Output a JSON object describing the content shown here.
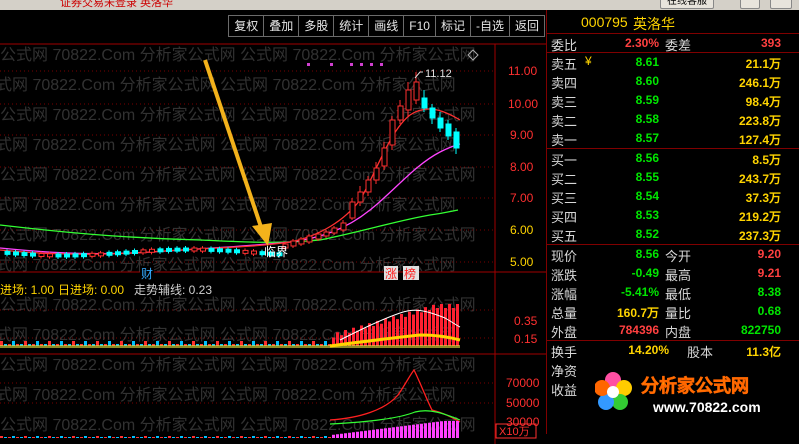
{
  "window": {
    "title_fragment": "证券交易未登录  英洛华",
    "corner_button": "在线客服"
  },
  "toolbar": {
    "buttons": [
      "复权",
      "叠加",
      "多股",
      "统计",
      "画线",
      "F10",
      "标记",
      "-自选",
      "返回"
    ]
  },
  "chart": {
    "price_axis": [
      "11.00",
      "10.00",
      "9.00",
      "8.00",
      "7.00",
      "6.00",
      "5.00"
    ],
    "high_marker": "11.12",
    "annotation_label": "临界",
    "event_labels": [
      "财",
      "涨",
      "榜"
    ],
    "indicator_labels": {
      "entry": "进场: 1.00",
      "day_entry": "日进场: 0.00",
      "trend_line": "走势辅线: 0.23"
    },
    "indicator_axis": [
      "0.35",
      "0.15"
    ],
    "volume_axis": [
      "70000",
      "50000",
      "30000"
    ],
    "volume_unit": "X10万",
    "colors": {
      "up": "#ff3030",
      "down": "#00ffff",
      "ma_short": "#ff3030",
      "ma_mid": "#ff44ff",
      "ma_long": "#33ff33",
      "arrow": "#f3b21b"
    }
  },
  "quote": {
    "code": "000795",
    "name": "英洛华",
    "webi": {
      "label": "委比",
      "value": "2.30%",
      "label2": "委差",
      "value2": "393"
    },
    "sell": [
      {
        "label": "卖五",
        "flag": "¥",
        "price": "8.61",
        "qty": "21.1万"
      },
      {
        "label": "卖四",
        "price": "8.60",
        "qty": "246.1万"
      },
      {
        "label": "卖三",
        "price": "8.59",
        "qty": "98.4万"
      },
      {
        "label": "卖二",
        "price": "8.58",
        "qty": "223.8万"
      },
      {
        "label": "卖一",
        "price": "8.57",
        "qty": "127.4万"
      }
    ],
    "buy": [
      {
        "label": "买一",
        "price": "8.56",
        "qty": "8.5万"
      },
      {
        "label": "买二",
        "price": "8.55",
        "qty": "243.7万"
      },
      {
        "label": "买三",
        "price": "8.54",
        "qty": "37.3万"
      },
      {
        "label": "买四",
        "price": "8.53",
        "qty": "219.2万"
      },
      {
        "label": "买五",
        "price": "8.52",
        "qty": "237.3万"
      }
    ],
    "stats": [
      {
        "l": "现价",
        "v": "8.56",
        "vc": "green",
        "l2": "今开",
        "v2": "9.20",
        "v2c": "red"
      },
      {
        "l": "涨跌",
        "v": "-0.49",
        "vc": "green",
        "l2": "最高",
        "v2": "9.21",
        "v2c": "red"
      },
      {
        "l": "涨幅",
        "v": "-5.41%",
        "vc": "green",
        "l2": "最低",
        "v2": "8.38",
        "v2c": "green"
      },
      {
        "l": "总量",
        "v": "160.7万",
        "vc": "yellow",
        "l2": "量比",
        "v2": "0.68",
        "v2c": "green"
      },
      {
        "l": "外盘",
        "v": "784396",
        "vc": "red",
        "l2": "内盘",
        "v2": "822750",
        "v2c": "green"
      }
    ],
    "extra": [
      {
        "l": "换手",
        "v": "14.20%",
        "l2": "股本",
        "v2": "11.3亿"
      },
      {
        "l": "净资",
        "v": "",
        "l2": "",
        "v2": ""
      },
      {
        "l": "收益",
        "v": "",
        "l2": "",
        "v2": ""
      }
    ]
  },
  "watermark": {
    "text": "公式网  70822.Com  分析家公式网",
    "logo_title": "分析家公式网",
    "logo_url": "www.70822.com"
  }
}
